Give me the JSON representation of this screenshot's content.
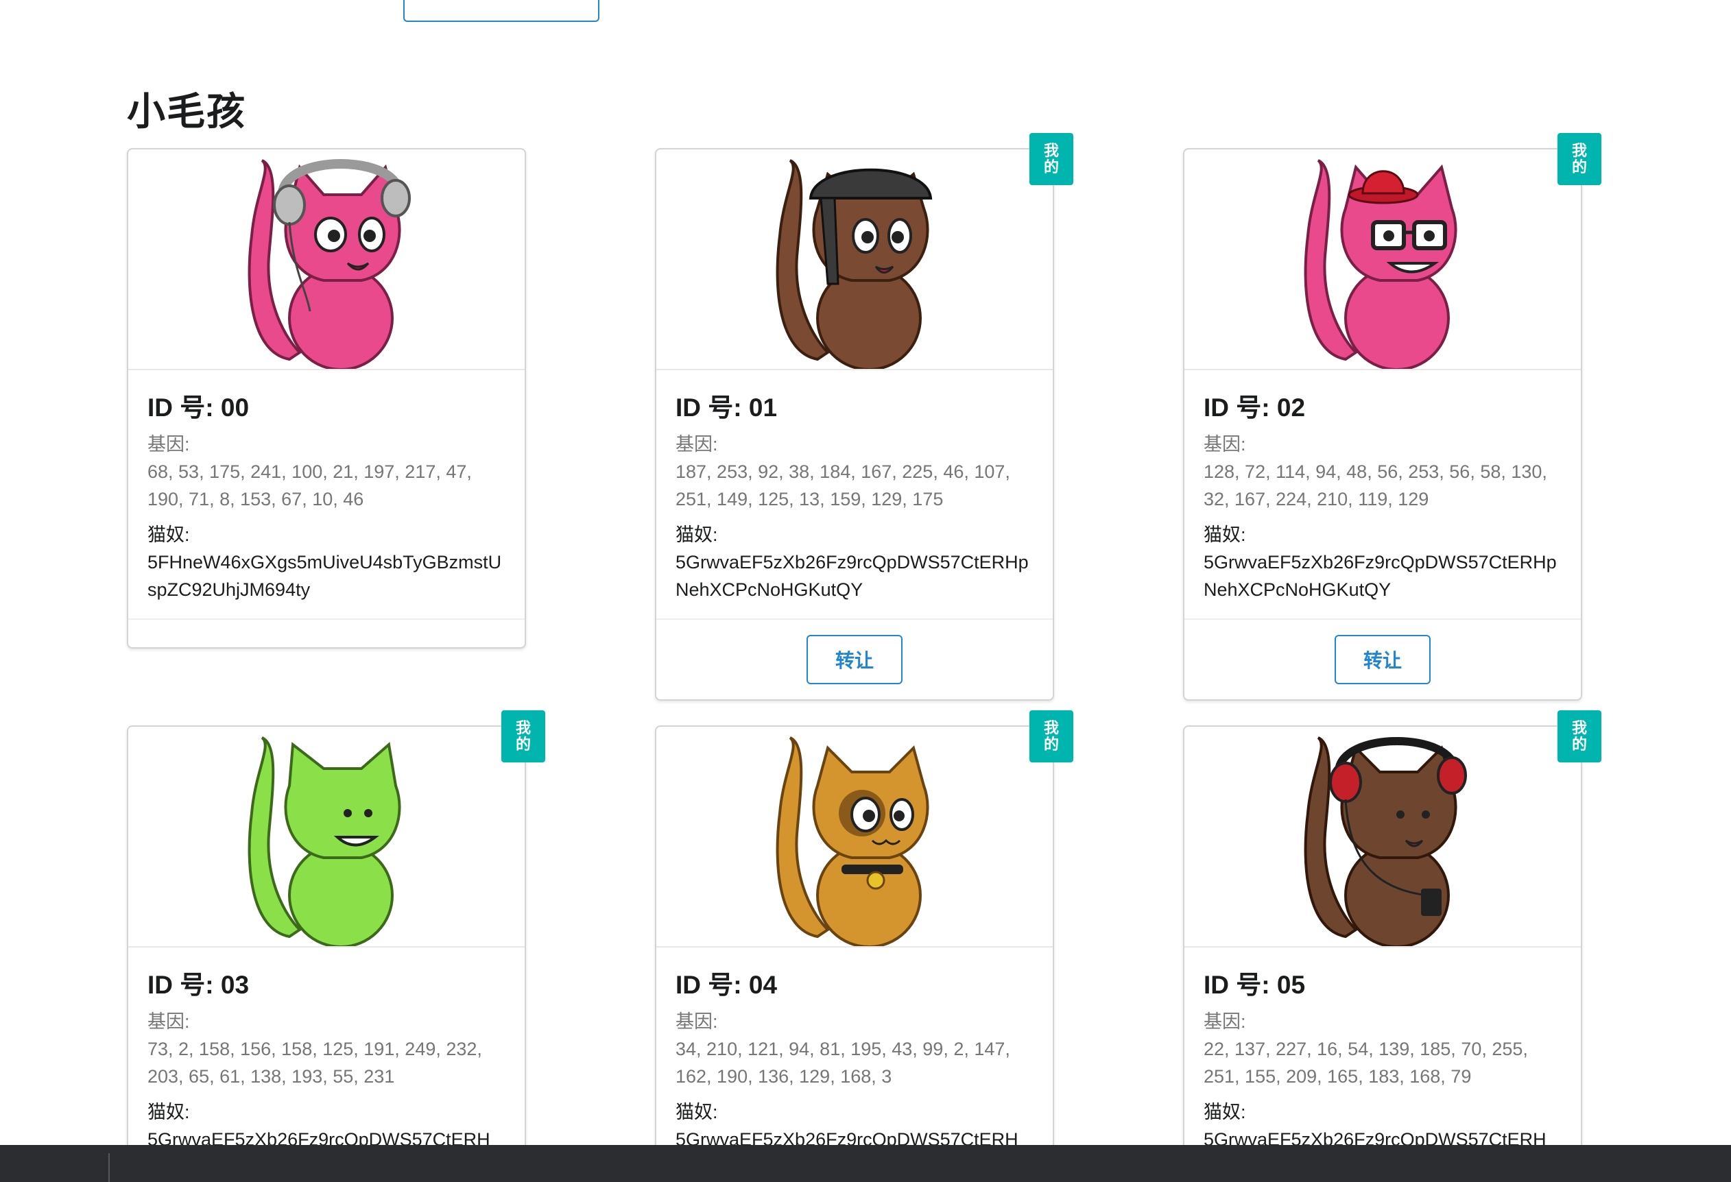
{
  "page": {
    "title": "小毛孩"
  },
  "labels": {
    "genes": "基因:",
    "owner": "猫奴:",
    "mine": [
      "我",
      "的"
    ],
    "transfer": "转让"
  },
  "cats": [
    {
      "id": "ID 号: 00",
      "genes": "68, 53, 175, 241, 100, 21, 197, 217, 47, 190, 71, 8, 153, 67, 10, 46",
      "owner": "5FHneW46xGXgs5mUiveU4sbTyGBzmstUspZC92UhjJM694ty",
      "mine": false,
      "color": "#e94a8b",
      "accessory": "headphones-silver"
    },
    {
      "id": "ID 号: 01",
      "genes": "187, 253, 92, 38, 184, 167, 225, 46, 107, 251, 149, 125, 13, 159, 129, 175",
      "owner": "5GrwvaEF5zXb26Fz9rcQpDWS57CtERHpNehXCPcNoHGKutQY",
      "mine": true,
      "color": "#7a4a32",
      "accessory": "bandana"
    },
    {
      "id": "ID 号: 02",
      "genes": "128, 72, 114, 94, 48, 56, 253, 56, 58, 130, 32, 167, 224, 210, 119, 129",
      "owner": "5GrwvaEF5zXb26Fz9rcQpDWS57CtERHpNehXCPcNoHGKutQY",
      "mine": true,
      "color": "#e94a8b",
      "accessory": "hat-glasses"
    },
    {
      "id": "ID 号: 03",
      "genes": "73, 2, 158, 156, 158, 125, 191, 249, 232, 203, 65, 61, 138, 193, 55, 231",
      "owner": "5GrwvaEF5zXb26Fz9rcQpDWS57CtERH",
      "mine": true,
      "color": "#8be04a",
      "accessory": "none"
    },
    {
      "id": "ID 号: 04",
      "genes": "34, 210, 121, 94, 81, 195, 43, 99, 2, 147, 162, 190, 136, 129, 168, 3",
      "owner": "5GrwvaEF5zXb26Fz9rcQpDWS57CtERH",
      "mine": true,
      "color": "#d4952e",
      "accessory": "collar-bell"
    },
    {
      "id": "ID 号: 05",
      "genes": "22, 137, 227, 16, 54, 139, 185, 70, 255, 251, 155, 209, 165, 183, 168, 79",
      "owner": "5GrwvaEF5zXb26Fz9rcQpDWS57CtERH",
      "mine": true,
      "color": "#6e4630",
      "accessory": "headphones-red"
    }
  ]
}
